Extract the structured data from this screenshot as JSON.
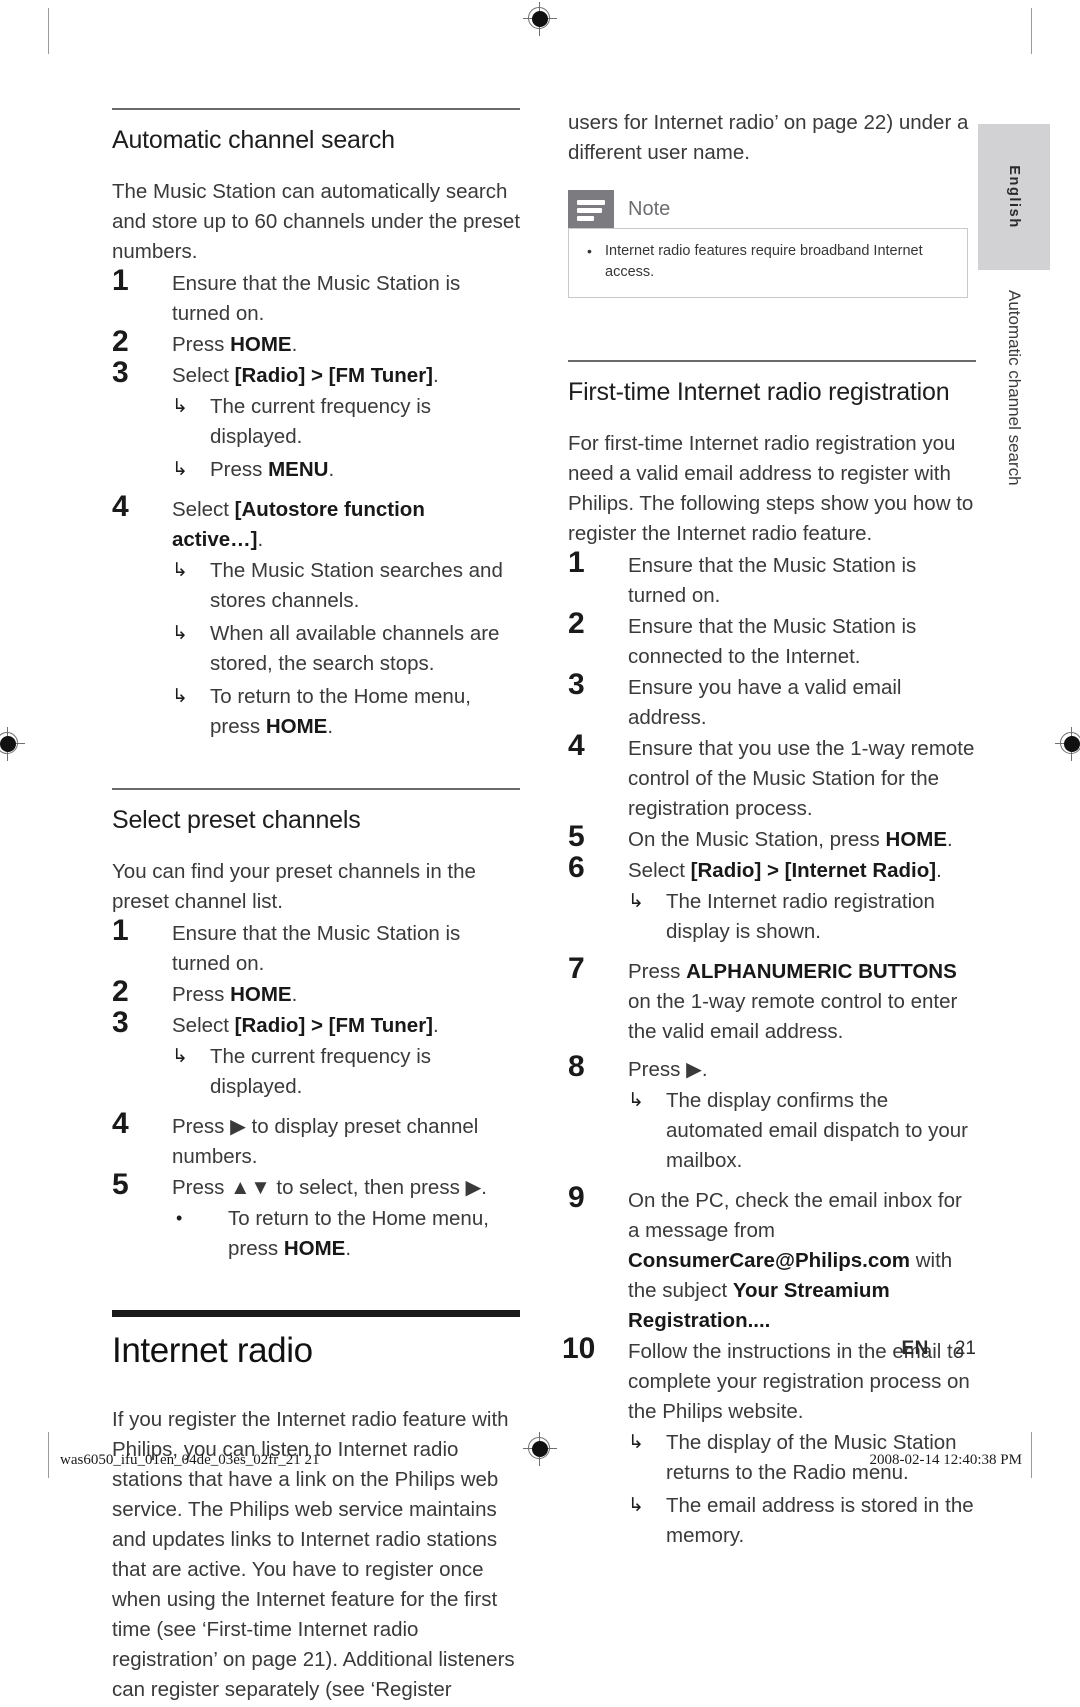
{
  "document": {
    "language_tab": "English",
    "margin_running_head": "Automatic channel search",
    "page_label": "EN",
    "page_number": "21",
    "print_footer_file": "was6050_ifu_01en_04de_03es_02fr_21   21",
    "print_footer_timestamp": "2008-02-14   12:40:38 PM"
  },
  "left_column": {
    "section_1": {
      "title": "Automatic channel search",
      "intro": "The Music Station can automatically search and store up to 60 channels under the preset numbers.",
      "steps": [
        {
          "num": "1",
          "text": "Ensure that the Music Station is turned on."
        },
        {
          "num": "2",
          "text_before": "Press ",
          "bold": "HOME",
          "text_after": "."
        },
        {
          "num": "3",
          "text_before": "Select ",
          "bold": "[Radio] > [FM Tuner]",
          "text_after": ".",
          "results": [
            {
              "text": "The current frequency is displayed."
            },
            {
              "text_before": "Press ",
              "bold": "MENU",
              "text_after": "."
            }
          ]
        },
        {
          "num": "4",
          "text_before": "Select ",
          "bold": "[Autostore function active…]",
          "text_after": ".",
          "results": [
            {
              "text": "The Music Station searches and stores channels."
            },
            {
              "text": "When all available channels are stored, the search stops."
            },
            {
              "text_before": "To return to the Home menu, press ",
              "bold": "HOME",
              "text_after": "."
            }
          ]
        }
      ]
    },
    "section_2": {
      "title": "Select preset channels",
      "intro": "You can find your preset channels in the preset channel list.",
      "steps": [
        {
          "num": "1",
          "text": "Ensure that the Music Station is turned on."
        },
        {
          "num": "2",
          "text_before": "Press ",
          "bold": "HOME",
          "text_after": "."
        },
        {
          "num": "3",
          "text_before": "Select ",
          "bold": "[Radio] > [FM Tuner]",
          "text_after": ".",
          "results": [
            {
              "text": "The current frequency is displayed."
            }
          ]
        },
        {
          "num": "4",
          "text": "Press ▶ to display preset channel numbers."
        },
        {
          "num": "5",
          "text": "Press ▲▼ to select, then press ▶.",
          "bullets": [
            {
              "text_before": "To return to the Home menu, press ",
              "bold": "HOME",
              "text_after": "."
            }
          ]
        }
      ]
    },
    "chapter": {
      "title": "Internet radio",
      "intro": "If you register the Internet radio feature with Philips, you can listen to Internet radio stations that have a link on the Philips web service. The Philips web service maintains and updates links to Internet radio stations that are active. You have to register once when using the Internet feature for the first time (see ‘First-time Internet radio registration’ on page 21). Additional listeners can register separately (see ‘Register"
    }
  },
  "right_column": {
    "continuation": "users for Internet radio’ on page 22) under a different user name.",
    "note": {
      "title": "Note",
      "icon": "note-lines-icon",
      "items": [
        "Internet radio features require broadband Internet access."
      ]
    },
    "section": {
      "title": "First-time Internet radio registration",
      "intro": "For first-time Internet radio registration you need a valid email address to register with Philips. The following steps show you how to register the Internet radio feature.",
      "steps": [
        {
          "num": "1",
          "text": "Ensure that the Music Station is turned on."
        },
        {
          "num": "2",
          "text": "Ensure that the Music Station is connected to the Internet."
        },
        {
          "num": "3",
          "text": "Ensure you have a valid email address."
        },
        {
          "num": "4",
          "text": "Ensure that you use the 1-way remote control of the Music Station for the registration process."
        },
        {
          "num": "5",
          "text_before": "On the Music Station, press ",
          "bold": "HOME",
          "text_after": "."
        },
        {
          "num": "6",
          "text_before": "Select ",
          "bold": "[Radio] > [Internet Radio]",
          "text_after": ".",
          "results": [
            {
              "text": "The Internet radio registration display is shown."
            }
          ]
        },
        {
          "num": "7",
          "text_before": "Press ",
          "bold": "ALPHANUMERIC BUTTONS",
          "text_after": " on the 1-way remote control to enter the valid email address."
        },
        {
          "num": "8",
          "text": "Press ▶.",
          "results": [
            {
              "text": "The display confirms the automated email dispatch to your mailbox."
            }
          ]
        },
        {
          "num": "9",
          "text_before": "On the PC, check the email inbox for a message from ",
          "bold": "ConsumerCare@Philips.com",
          "text_mid": " with the subject ",
          "bold2": "Your Streamium Registration....",
          "text_after": ""
        },
        {
          "num": "10",
          "text": "Follow the instructions in the email to complete your registration process on the Philips website.",
          "results": [
            {
              "text": "The display of the Music Station returns to the Radio menu."
            },
            {
              "text": "The email address is stored in the memory."
            }
          ]
        }
      ]
    }
  }
}
